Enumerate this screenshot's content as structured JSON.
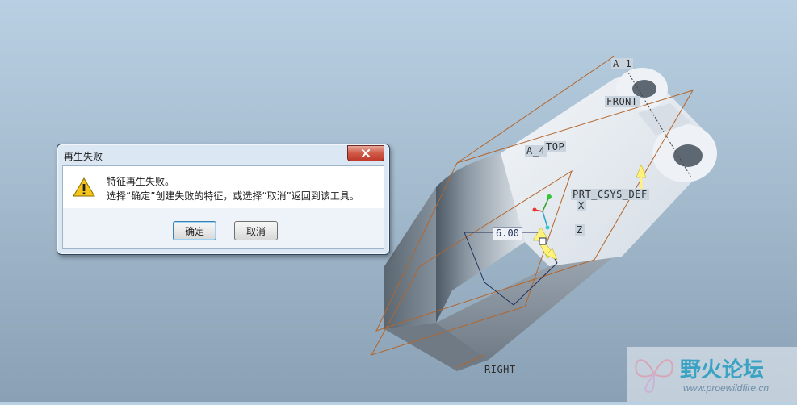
{
  "viewport": {
    "datum_labels": {
      "a1": "A_1",
      "front": "FRONT",
      "a4": "A_4",
      "top": "TOP",
      "csys": "PRT_CSYS_DEF",
      "right": "RIGHT",
      "x": "X",
      "z": "Z"
    },
    "dimension": "6.00"
  },
  "dialog": {
    "title": "再生失败",
    "message_line1": "特征再生失败。",
    "message_line2": "选择“确定”创建失败的特征，或选择“取消”返回到该工具。",
    "ok_label": "确定",
    "cancel_label": "取消"
  },
  "watermark": {
    "name": "野火论坛",
    "url": "www.proewildfire.cn"
  }
}
